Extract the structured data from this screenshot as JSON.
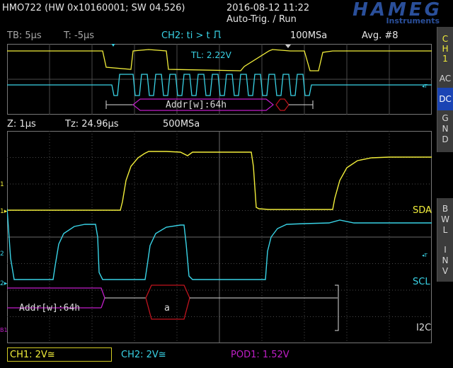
{
  "header": {
    "device": "HMO722 (HW 0x10160001; SW 04.526)",
    "datetime": "2016-08-12 11:22",
    "trigger_mode": "Auto-Trig. / Run",
    "logo_brand": "HAMEG",
    "logo_sub": "Instruments"
  },
  "status_row": {
    "timebase": "TB: 5µs",
    "trigger_pos": "T: -5µs",
    "trigger_cond": "CH2: ti > t",
    "sample_rate": "100MSa",
    "avg": "Avg. #8"
  },
  "overview": {
    "trigger_level": "TL: 2.22V",
    "decode_label": "Addr[w]:64h"
  },
  "zoom_row": {
    "zoom": "Z: 1µs",
    "tz": "Tz: 24.96µs",
    "sample_rate": "500MSa"
  },
  "traces": {
    "sda_label": "SDA",
    "scl_label": "SCL",
    "bus_label": "I2C",
    "decode_addr": "Addr[w]:64h",
    "decode_data": "a"
  },
  "sidebar_top": {
    "items": [
      "C",
      "H",
      "1"
    ],
    "buttons": [
      "AC",
      "DC",
      "G\nN\nD"
    ],
    "active": "DC"
  },
  "sidebar_bottom": {
    "buttons": [
      "B\nW\nL",
      "I\nN\nV"
    ]
  },
  "bottom_bar": {
    "ch1": "CH1: 2V≅",
    "ch2": "CH2: 2V≅",
    "pod": "POD1: 1.52V"
  },
  "colors": {
    "ch1": "#f2ee3a",
    "ch2": "#39d3e6",
    "bus": "#c01ec8",
    "bus_data_frame": "#c0141e",
    "grid": "#5a5a5a",
    "brand": "#2a4f9a",
    "sidebar_active": "#1a44b4"
  }
}
